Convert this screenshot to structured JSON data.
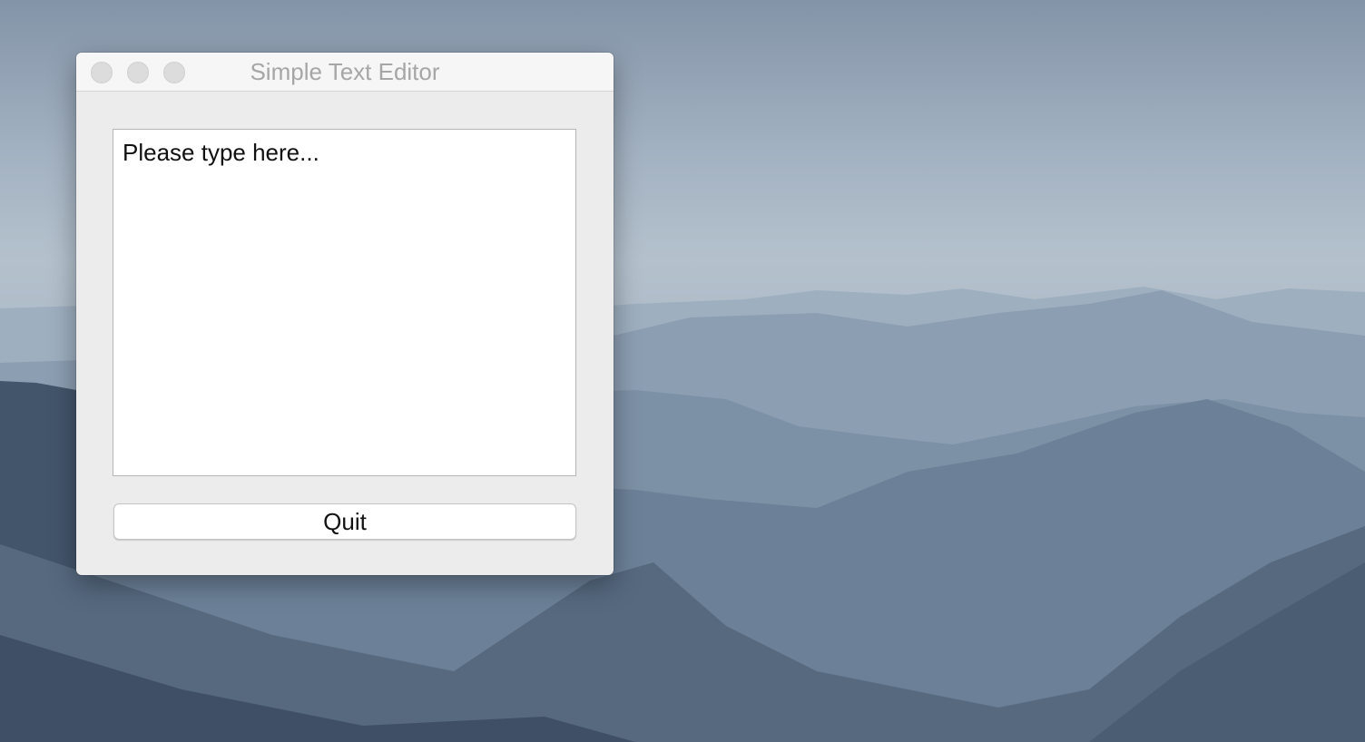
{
  "window": {
    "title": "Simple Text Editor"
  },
  "editor": {
    "text": "Please type here..."
  },
  "buttons": {
    "quit_label": "Quit"
  },
  "icons": {
    "close": "close-icon",
    "minimize": "minimize-icon",
    "zoom": "zoom-icon"
  },
  "colors": {
    "window_background": "#ececec",
    "titlebar_background": "#f6f6f6",
    "title_text": "#a6a6a6",
    "traffic_light_inactive": "#dcdcdc",
    "editor_background": "#ffffff",
    "button_background": "#ffffff"
  }
}
